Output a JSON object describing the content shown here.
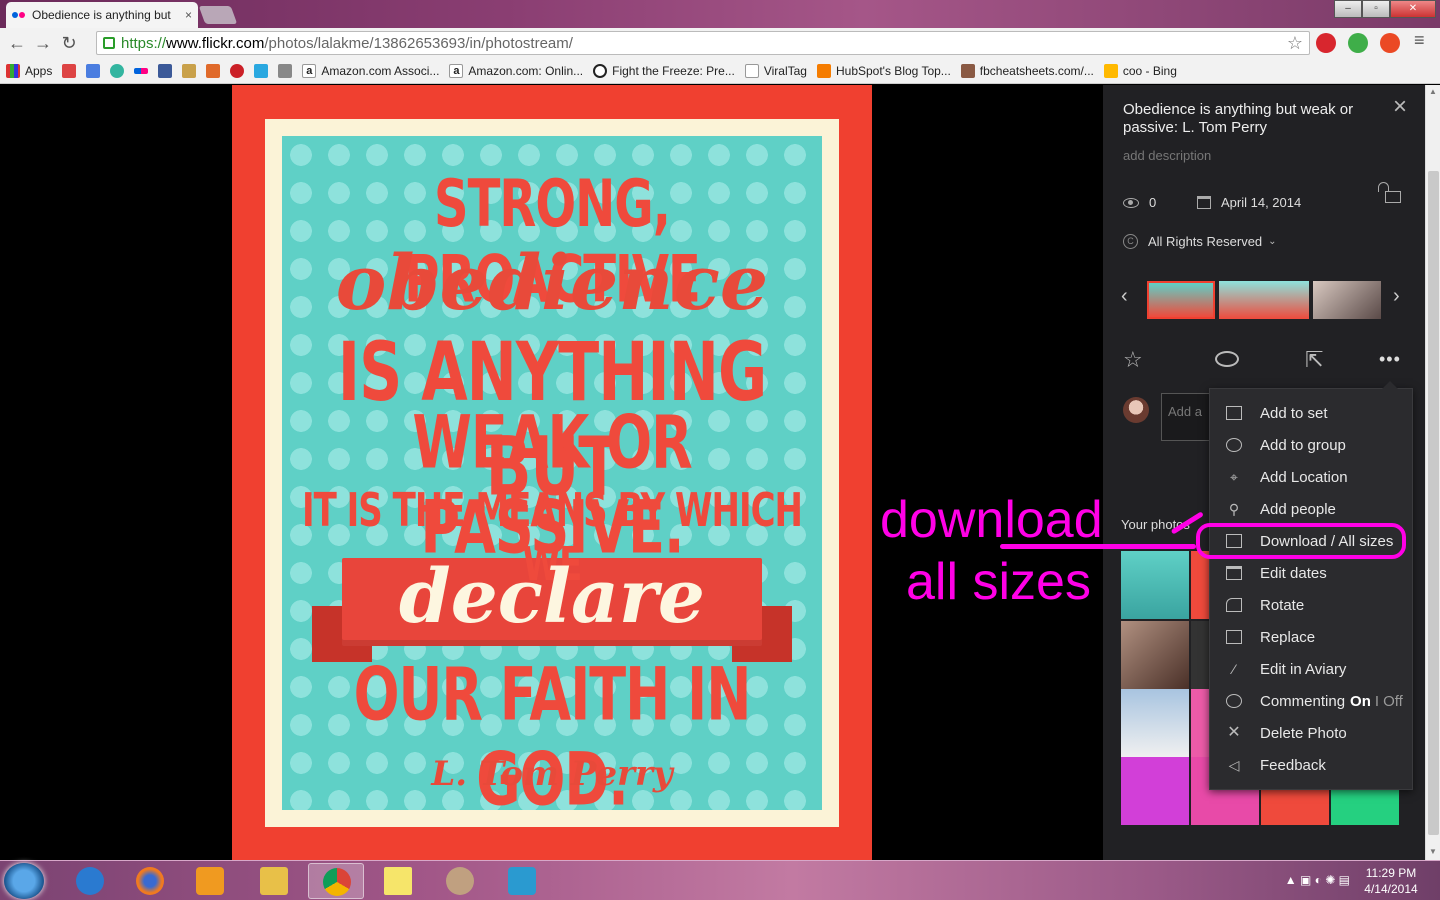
{
  "browser": {
    "tab_title": "Obedience is anything but",
    "tab_close": "×",
    "url_https": "https://",
    "url_domain": "www.flickr.com",
    "url_path": "/photos/lalakme/13862653693/in/photostream/",
    "window_controls": [
      "–",
      "▫",
      "✕"
    ]
  },
  "bookmarks": {
    "apps": "Apps",
    "items": [
      "Amazon.com Associ...",
      "Amazon.com: Onlin...",
      "Fight the Freeze: Pre...",
      "ViralTag",
      "HubSpot's Blog Top...",
      "fbcheatsheets.com/...",
      "coo - Bing"
    ]
  },
  "poster": {
    "line1": "STRONG, PROACTIVE",
    "line2": "obedience",
    "line3": "IS ANYTHING BUT",
    "line4": "WEAK OR PASSIVE.",
    "line5": "IT IS THE MEANS BY WHICH WE",
    "line6": "declare",
    "line7": "OUR FAITH IN GOD.",
    "line8": "L. Tom Perry"
  },
  "sidebar": {
    "title": "Obedience is anything but weak or passive: L. Tom Perry",
    "close": "×",
    "add_description": "add description",
    "views": "0",
    "date": "April 14, 2014",
    "rights": "All Rights Reserved",
    "prev": "‹",
    "next": "›",
    "comment_placeholder": "Add a",
    "your_photos": "Your photos"
  },
  "menu": {
    "items": [
      "Add to set",
      "Add to group",
      "Add Location",
      "Add people",
      "Download / All sizes",
      "Edit dates",
      "Rotate",
      "Replace",
      "Edit in Aviary",
      "Commenting",
      "Delete Photo",
      "Feedback"
    ],
    "commenting_on": "On",
    "commenting_sep": "I",
    "commenting_off": "Off"
  },
  "annotation": {
    "line1": "download",
    "line2": "all sizes"
  },
  "taskbar": {
    "time": "11:29 PM",
    "date": "4/14/2014"
  },
  "colors": {
    "annotation": "#ff00e6",
    "poster_red": "#f04030",
    "poster_teal": "#5fd0c6",
    "sidebar_bg": "#212124"
  }
}
